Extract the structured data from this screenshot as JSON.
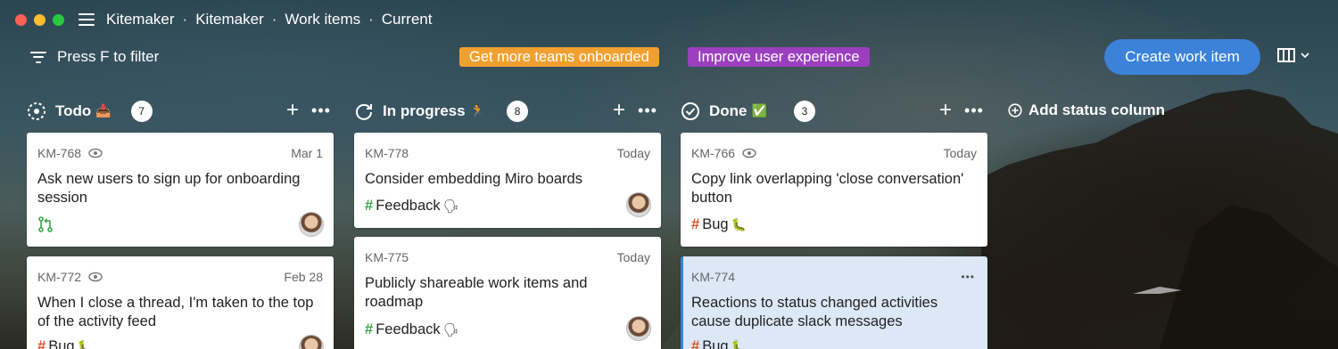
{
  "titlebar": {
    "crumbs": [
      "Kitemaker",
      "Kitemaker",
      "Work items",
      "Current"
    ],
    "separator": "·"
  },
  "toolbar": {
    "filter_label": "Press F to filter",
    "tags": [
      {
        "label": "Get more teams onboarded",
        "color": "#f0a030"
      },
      {
        "label": "Improve user experience",
        "color": "#9b3fbf"
      }
    ],
    "create_label": "Create work item"
  },
  "add_status_label": "Add status column",
  "columns": [
    {
      "name": "Todo",
      "emoji": "📥",
      "count": "7",
      "icon": "todo-circle-icon",
      "cards": [
        {
          "id": "KM-768",
          "date": "Mar 1",
          "title": "Ask new users to sign up for onboarding session",
          "label": "",
          "watch": true,
          "has_pr": true
        },
        {
          "id": "KM-772",
          "date": "Feb 28",
          "title": "When I close a thread, I'm taken to the top of the activity feed",
          "label": "Bug",
          "label_emoji": "🐛",
          "watch": true
        }
      ]
    },
    {
      "name": "In progress",
      "emoji": "🏃",
      "count": "8",
      "icon": "in-progress-icon",
      "cards": [
        {
          "id": "KM-778",
          "date": "Today",
          "title": "Consider embedding Miro boards",
          "label": "Feedback",
          "label_emoji": "🗣"
        },
        {
          "id": "KM-775",
          "date": "Today",
          "title": "Publicly shareable work items and roadmap",
          "label": "Feedback",
          "label_emoji": "🗣"
        }
      ]
    },
    {
      "name": "Done",
      "emoji": "✅",
      "count": "3",
      "icon": "done-check-icon",
      "cards": [
        {
          "id": "KM-766",
          "date": "Today",
          "title": "Copy link overlapping 'close conversation' button",
          "label": "Bug",
          "label_emoji": "🐛",
          "watch": true
        },
        {
          "id": "KM-774",
          "date": "",
          "title": "Reactions to status changed activities cause duplicate slack messages",
          "label": "Bug",
          "label_emoji": "🐛",
          "selected": true
        }
      ]
    }
  ],
  "colors": {
    "accent": "#3b82d8",
    "bug_hash": "#e0512c",
    "feedback_hash": "#3aa84a"
  }
}
